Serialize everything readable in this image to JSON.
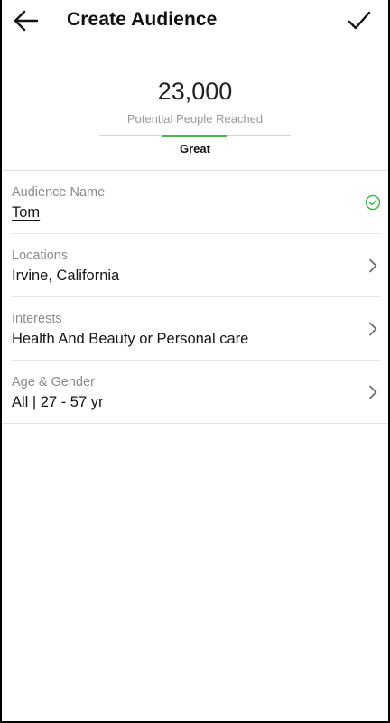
{
  "header": {
    "title": "Create Audience",
    "back_icon": "arrow-left-icon",
    "confirm_icon": "checkmark-icon"
  },
  "reach": {
    "count": "23,000",
    "label": "Potential People Reached",
    "rating": "Great",
    "meter_fill_fraction_start": 0.33,
    "meter_fill_fraction_end": 0.67,
    "meter_color": "#47b84e"
  },
  "fields": [
    {
      "label": "Audience Name",
      "value": "Tom",
      "icon": "check-circle-icon",
      "icon_color": "#47b84e"
    },
    {
      "label": "Locations",
      "value": "Irvine, California",
      "icon": "chevron-right-icon"
    },
    {
      "label": "Interests",
      "value": "Health And Beauty or Personal care",
      "icon": "chevron-right-icon"
    },
    {
      "label": "Age & Gender",
      "value": "All | 27 - 57 yr",
      "icon": "chevron-right-icon"
    }
  ]
}
